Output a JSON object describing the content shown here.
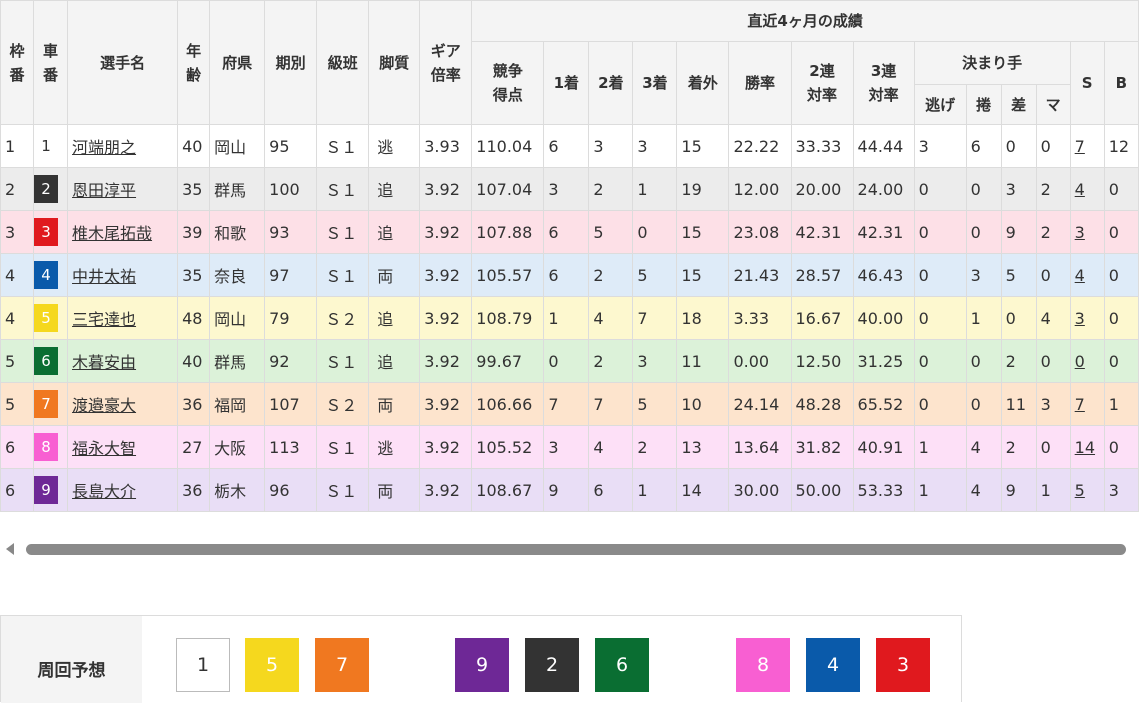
{
  "headers": {
    "waku": "枠番",
    "car": "車番",
    "name": "選手名",
    "age": "年齢",
    "pref": "府県",
    "term": "期別",
    "class": "級班",
    "leg": "脚質",
    "gear": "ギア倍率",
    "recent": "直近4ヶ月の成績",
    "score": "競争得点",
    "first": "1着",
    "second": "2着",
    "third": "3着",
    "out": "着外",
    "win_rate": "勝率",
    "ren2": "2連対率",
    "ren3": "3連対率",
    "kimarite": "決まり手",
    "nige": "逃げ",
    "makuri": "捲",
    "sashi": "差",
    "mark": "マ",
    "s": "S",
    "b": "B"
  },
  "rows": [
    {
      "waku": "1",
      "car": "1",
      "name": "河端朋之",
      "age": "40",
      "pref": "岡山",
      "term": "95",
      "class": "Ｓ１",
      "leg": "逃",
      "gear": "3.93",
      "score": "110.04",
      "first": "6",
      "second": "3",
      "third": "3",
      "out": "15",
      "win": "22.22",
      "r2": "33.33",
      "r3": "44.44",
      "nige": "3",
      "makuri": "6",
      "sashi": "0",
      "mark": "0",
      "s": "7",
      "b": "12"
    },
    {
      "waku": "2",
      "car": "2",
      "name": "恩田淳平",
      "age": "35",
      "pref": "群馬",
      "term": "100",
      "class": "Ｓ１",
      "leg": "追",
      "gear": "3.92",
      "score": "107.04",
      "first": "3",
      "second": "2",
      "third": "1",
      "out": "19",
      "win": "12.00",
      "r2": "20.00",
      "r3": "24.00",
      "nige": "0",
      "makuri": "0",
      "sashi": "3",
      "mark": "2",
      "s": "4",
      "b": "0"
    },
    {
      "waku": "3",
      "car": "3",
      "name": "椎木尾拓哉",
      "age": "39",
      "pref": "和歌",
      "term": "93",
      "class": "Ｓ１",
      "leg": "追",
      "gear": "3.92",
      "score": "107.88",
      "first": "6",
      "second": "5",
      "third": "0",
      "out": "15",
      "win": "23.08",
      "r2": "42.31",
      "r3": "42.31",
      "nige": "0",
      "makuri": "0",
      "sashi": "9",
      "mark": "2",
      "s": "3",
      "b": "0"
    },
    {
      "waku": "4",
      "car": "4",
      "name": "中井太祐",
      "age": "35",
      "pref": "奈良",
      "term": "97",
      "class": "Ｓ１",
      "leg": "両",
      "gear": "3.92",
      "score": "105.57",
      "first": "6",
      "second": "2",
      "third": "5",
      "out": "15",
      "win": "21.43",
      "r2": "28.57",
      "r3": "46.43",
      "nige": "0",
      "makuri": "3",
      "sashi": "5",
      "mark": "0",
      "s": "4",
      "b": "0"
    },
    {
      "waku": "4",
      "car": "5",
      "name": "三宅達也",
      "age": "48",
      "pref": "岡山",
      "term": "79",
      "class": "Ｓ２",
      "leg": "追",
      "gear": "3.92",
      "score": "108.79",
      "first": "1",
      "second": "4",
      "third": "7",
      "out": "18",
      "win": "3.33",
      "r2": "16.67",
      "r3": "40.00",
      "nige": "0",
      "makuri": "1",
      "sashi": "0",
      "mark": "4",
      "s": "3",
      "b": "0"
    },
    {
      "waku": "5",
      "car": "6",
      "name": "木暮安由",
      "age": "40",
      "pref": "群馬",
      "term": "92",
      "class": "Ｓ１",
      "leg": "追",
      "gear": "3.92",
      "score": "99.67",
      "first": "0",
      "second": "2",
      "third": "3",
      "out": "11",
      "win": "0.00",
      "r2": "12.50",
      "r3": "31.25",
      "nige": "0",
      "makuri": "0",
      "sashi": "2",
      "mark": "0",
      "s": "0",
      "b": "0"
    },
    {
      "waku": "5",
      "car": "7",
      "name": "渡邉豪大",
      "age": "36",
      "pref": "福岡",
      "term": "107",
      "class": "Ｓ２",
      "leg": "両",
      "gear": "3.92",
      "score": "106.66",
      "first": "7",
      "second": "7",
      "third": "5",
      "out": "10",
      "win": "24.14",
      "r2": "48.28",
      "r3": "65.52",
      "nige": "0",
      "makuri": "0",
      "sashi": "11",
      "mark": "3",
      "s": "7",
      "b": "1"
    },
    {
      "waku": "6",
      "car": "8",
      "name": "福永大智",
      "age": "27",
      "pref": "大阪",
      "term": "113",
      "class": "Ｓ１",
      "leg": "逃",
      "gear": "3.92",
      "score": "105.52",
      "first": "3",
      "second": "4",
      "third": "2",
      "out": "13",
      "win": "13.64",
      "r2": "31.82",
      "r3": "40.91",
      "nige": "1",
      "makuri": "4",
      "sashi": "2",
      "mark": "0",
      "s": "14",
      "b": "0"
    },
    {
      "waku": "6",
      "car": "9",
      "name": "長島大介",
      "age": "36",
      "pref": "栃木",
      "term": "96",
      "class": "Ｓ１",
      "leg": "両",
      "gear": "3.92",
      "score": "108.67",
      "first": "9",
      "second": "6",
      "third": "1",
      "out": "14",
      "win": "30.00",
      "r2": "50.00",
      "r3": "53.33",
      "nige": "1",
      "makuri": "4",
      "sashi": "9",
      "mark": "1",
      "s": "5",
      "b": "3"
    }
  ],
  "car_colors": {
    "1": {
      "bg": "#ffffff",
      "fg": "#333333"
    },
    "2": {
      "bg": "#333333",
      "fg": "#ffffff"
    },
    "3": {
      "bg": "#e0191e",
      "fg": "#ffffff"
    },
    "4": {
      "bg": "#0a5aaa",
      "fg": "#ffffff"
    },
    "5": {
      "bg": "#f5d81e",
      "fg": "#ffffff"
    },
    "6": {
      "bg": "#0a6e32",
      "fg": "#ffffff"
    },
    "7": {
      "bg": "#f07820",
      "fg": "#ffffff"
    },
    "8": {
      "bg": "#f85fd2",
      "fg": "#ffffff"
    },
    "9": {
      "bg": "#6e2896",
      "fg": "#ffffff"
    }
  },
  "forecast": {
    "label": "周回予想",
    "order": [
      "1",
      "5",
      "7",
      "9",
      "2",
      "6",
      "8",
      "4",
      "3"
    ]
  }
}
